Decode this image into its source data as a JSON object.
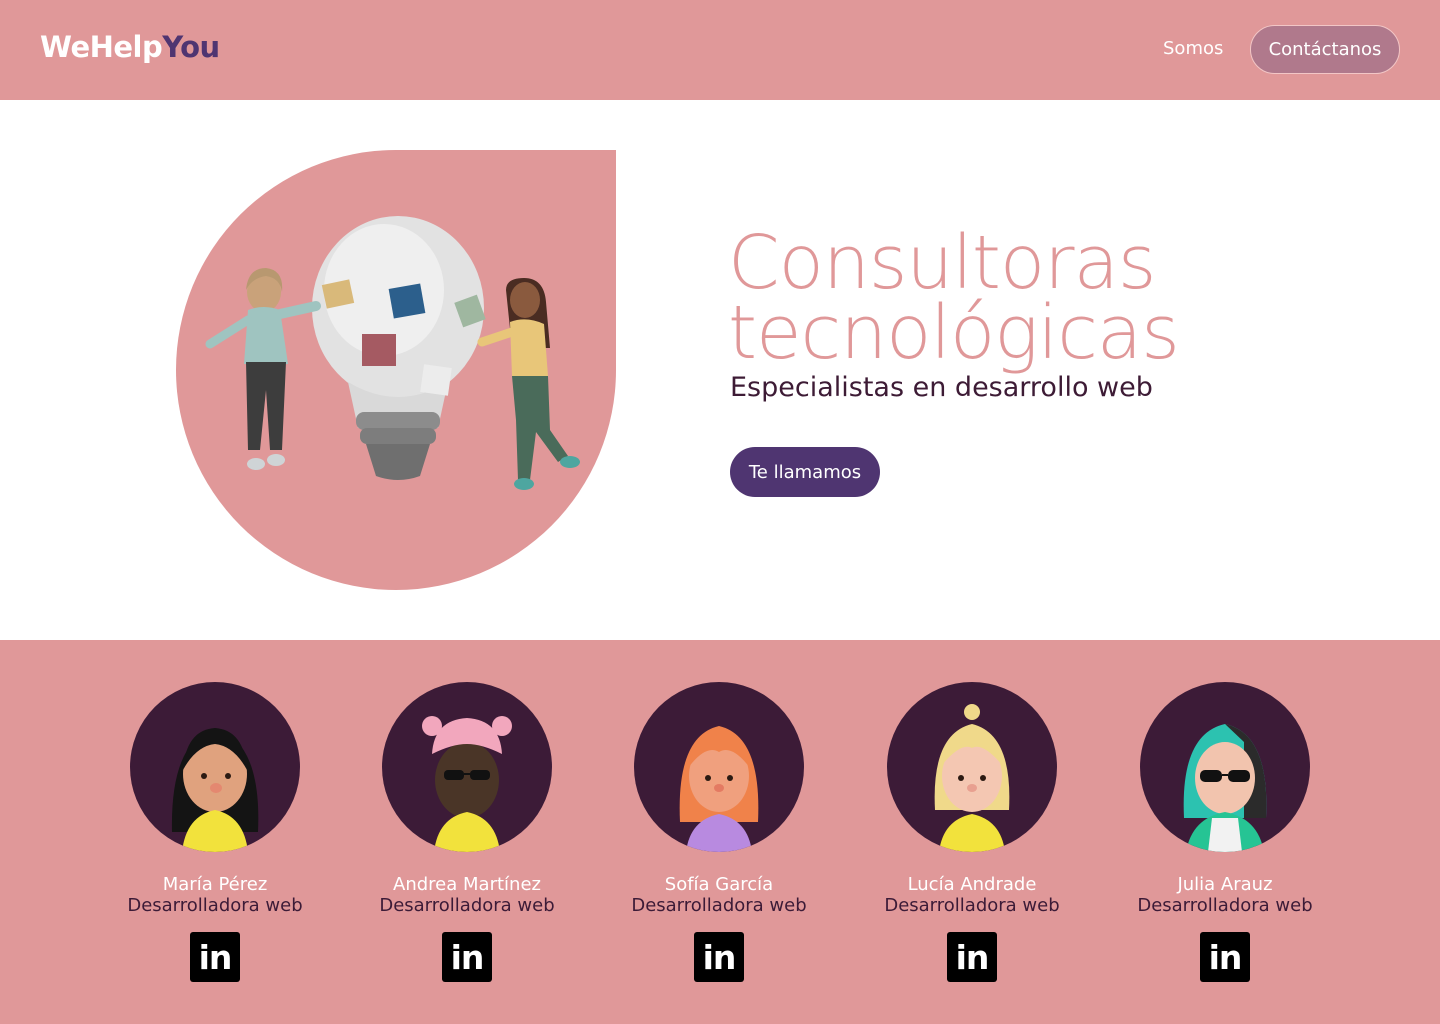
{
  "brand": {
    "logo_main": "WeHelp",
    "logo_accent": "You"
  },
  "nav": {
    "somos": "Somos",
    "contact": "Contáctanos"
  },
  "hero": {
    "title_line1": "Consultoras",
    "title_line2": "tecnológicas",
    "subtitle": "Especialistas en desarrollo web",
    "cta": "Te llamamos"
  },
  "team": [
    {
      "name": "María Pérez",
      "role": "Desarrolladora web",
      "linkedin_label": "in"
    },
    {
      "name": "Andrea Martínez",
      "role": "Desarrolladora web",
      "linkedin_label": "in"
    },
    {
      "name": "Sofía García",
      "role": "Desarrolladora web",
      "linkedin_label": "in"
    },
    {
      "name": "Lucía Andrade",
      "role": "Desarrolladora web",
      "linkedin_label": "in"
    },
    {
      "name": "Julia Arauz",
      "role": "Desarrolladora web",
      "linkedin_label": "in"
    }
  ],
  "colors": {
    "brand_pink": "#e09899",
    "brand_purple": "#4f3571",
    "dark_plum": "#3c1b37",
    "contact_button": "#b0798c"
  }
}
